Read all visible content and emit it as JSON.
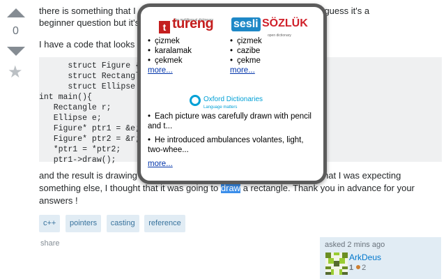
{
  "vote": {
    "count": "0",
    "star_glyph": "★"
  },
  "question": {
    "p1": "there is something that I c… need some help. I guess it's a beginner question but it's",
    "p1_a": "there is something that I c",
    "p1_b": "need some help. I guess it's a",
    "p1_c": "beginner question but it's",
    "p2": "I have a code that looks",
    "code_lines": [
      "      struct Figure {..",
      "      struct Rectangle",
      "      struct Ellipse :",
      "int main(){",
      "   Rectangle r;",
      "   Ellipse e;",
      "   Figure* ptr1 = &e;",
      "   Figure* ptr2 = &r;",
      "   *ptr1 = *ptr2;",
      "   ptr1->draw();"
    ],
    "p3_line1_a": "and the result is drawing a",
    "p3_line1_b": "means that I was expecting",
    "p3_line2_a": "something else, I thought that it was going to ",
    "p3_highlight": "draw",
    "p3_line2_b": " a rectangle. Thank you in advance for your",
    "p3_line3": "answers !"
  },
  "tags": [
    "c++",
    "pointers",
    "casting",
    "reference"
  ],
  "share_label": "share",
  "owner": {
    "asked": "asked 2 mins ago",
    "name": "ArkDeus",
    "rep": "1",
    "bronze": "2"
  },
  "popup": {
    "tureng": {
      "logo_word": "tureng",
      "logo_box": "t",
      "logo_tagline": "the multilingual dictionary",
      "items": [
        "çizmek",
        "karalamak",
        "çekmek"
      ],
      "more": "more..."
    },
    "sesli": {
      "logo_a": "sesli",
      "logo_b": "SÖZLÜK",
      "logo_tagline": "open dictionary",
      "items": [
        "çizmek",
        "cazibe",
        "çekme"
      ],
      "more": "more..."
    },
    "oxford": {
      "logo_a": "Oxford Dictionaries",
      "logo_b": "Language matters",
      "items": [
        "Each picture was carefully drawn with pencil and t...",
        "He introduced ambulances volantes, light, two-whee..."
      ],
      "more": "more..."
    }
  },
  "colors": {
    "accent": "#0077cc",
    "tag_bg": "#e1ecf4",
    "highlight": "#3b8eea"
  }
}
